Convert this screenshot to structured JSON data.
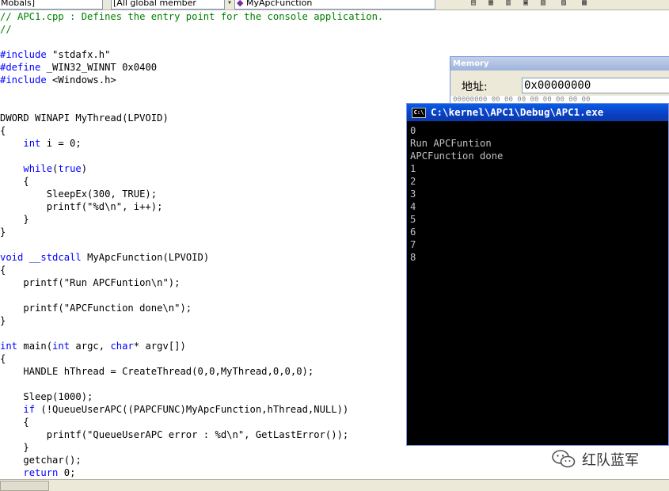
{
  "toolbar": {
    "combo_class": "Mobals]",
    "combo_members": "[All global member",
    "combo_function": "MyApcFunction"
  },
  "code_lines": [
    [
      {
        "t": "// APC1.cpp : Defines the entry point for the console application.",
        "c": "comment"
      }
    ],
    [
      {
        "t": "//",
        "c": "comment"
      }
    ],
    [],
    [
      {
        "t": "#include",
        "c": "kw"
      },
      {
        "t": " \"stdafx.h\"",
        "c": ""
      }
    ],
    [
      {
        "t": "#define",
        "c": "kw"
      },
      {
        "t": " _WIN32_WINNT 0x0400",
        "c": ""
      }
    ],
    [
      {
        "t": "#include",
        "c": "kw"
      },
      {
        "t": " <Windows.h>",
        "c": ""
      }
    ],
    [],
    [],
    [
      {
        "t": "DWORD WINAPI MyThread(LPVOID)",
        "c": ""
      }
    ],
    [
      {
        "t": "{",
        "c": ""
      }
    ],
    [
      {
        "t": "    ",
        "c": ""
      },
      {
        "t": "int",
        "c": "kw"
      },
      {
        "t": " i = 0;",
        "c": ""
      }
    ],
    [],
    [
      {
        "t": "    ",
        "c": ""
      },
      {
        "t": "while",
        "c": "kw"
      },
      {
        "t": "(",
        "c": ""
      },
      {
        "t": "true",
        "c": "kw"
      },
      {
        "t": ")",
        "c": ""
      }
    ],
    [
      {
        "t": "    {",
        "c": ""
      }
    ],
    [
      {
        "t": "        SleepEx(300, TRUE);",
        "c": ""
      }
    ],
    [
      {
        "t": "        printf(\"%d\\n\", i++);",
        "c": ""
      }
    ],
    [
      {
        "t": "    }",
        "c": ""
      }
    ],
    [
      {
        "t": "}",
        "c": ""
      }
    ],
    [],
    [
      {
        "t": "void",
        "c": "kw"
      },
      {
        "t": " ",
        "c": ""
      },
      {
        "t": "__stdcall",
        "c": "kw"
      },
      {
        "t": " MyApcFunction(LPVOID)",
        "c": ""
      }
    ],
    [
      {
        "t": "{",
        "c": ""
      }
    ],
    [
      {
        "t": "    printf(\"Run APCFuntion\\n\");",
        "c": ""
      }
    ],
    [],
    [
      {
        "t": "    printf(\"APCFunction done\\n\");",
        "c": ""
      }
    ],
    [
      {
        "t": "}",
        "c": ""
      }
    ],
    [],
    [
      {
        "t": "int",
        "c": "kw"
      },
      {
        "t": " main(",
        "c": ""
      },
      {
        "t": "int",
        "c": "kw"
      },
      {
        "t": " argc, ",
        "c": ""
      },
      {
        "t": "char",
        "c": "kw"
      },
      {
        "t": "* argv[])",
        "c": ""
      }
    ],
    [
      {
        "t": "{",
        "c": ""
      }
    ],
    [
      {
        "t": "    HANDLE hThread = CreateThread(0,0,MyThread,0,0,0);",
        "c": ""
      }
    ],
    [],
    [
      {
        "t": "    Sleep(1000);",
        "c": ""
      }
    ],
    [
      {
        "t": "    ",
        "c": ""
      },
      {
        "t": "if",
        "c": "kw"
      },
      {
        "t": " (!QueueUserAPC((PAPCFUNC)MyApcFunction,hThread,NULL))",
        "c": ""
      }
    ],
    [
      {
        "t": "    {",
        "c": ""
      }
    ],
    [
      {
        "t": "        printf(\"QueueUserAPC error : %d\\n\", GetLastError());",
        "c": ""
      }
    ],
    [
      {
        "t": "    }",
        "c": ""
      }
    ],
    [
      {
        "t": "    getchar();",
        "c": ""
      }
    ],
    [
      {
        "t": "    ",
        "c": ""
      },
      {
        "t": "return",
        "c": "kw"
      },
      {
        "t": " 0;",
        "c": ""
      }
    ]
  ],
  "memory_window": {
    "title": "Memory",
    "address_label": "地址:",
    "address_value": "0x00000000",
    "grid_text": "00000000  00 00 00 00 00 00 00 00"
  },
  "console": {
    "title": "C:\\kernel\\APC1\\Debug\\APC1.exe",
    "icon_text": "C:\\",
    "output": [
      "0",
      "Run APCFuntion",
      "APCFunction done",
      "1",
      "2",
      "3",
      "4",
      "5",
      "6",
      "7",
      "8"
    ]
  },
  "watermark": {
    "text": "红队蓝军"
  },
  "colors": {
    "comment": "#008000",
    "keyword": "#0000ff",
    "console_bg": "#000000",
    "console_fg": "#c0c0c0",
    "title_bar": "#0a4fd6"
  },
  "icons": {
    "console_app": "console-app-icon",
    "watermark": "wechat-logo-icon"
  }
}
